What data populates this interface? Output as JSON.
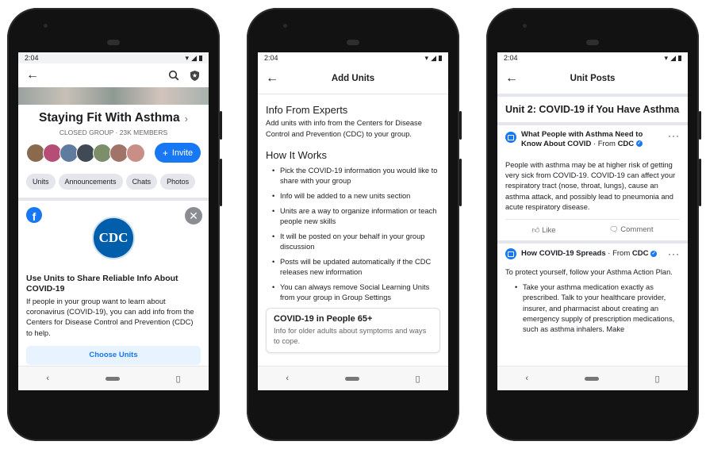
{
  "phone1": {
    "status_time": "2:04",
    "group_title": "Staying Fit With Asthma",
    "group_meta": "CLOSED GROUP · 23K MEMBERS",
    "invite_label": "Invite",
    "tabs": [
      "Units",
      "Announcements",
      "Chats",
      "Photos"
    ],
    "card": {
      "logo_text": "CDC",
      "heading": "Use Units to Share Reliable Info About COVID-19",
      "body": "If people in your group want to learn about coronavirus (COVID-19), you can add info from the Centers for Disease Control and Prevention (CDC) to help.",
      "button": "Choose Units"
    }
  },
  "phone2": {
    "status_time": "2:04",
    "title": "Add Units",
    "section1_heading": "Info From Experts",
    "section1_body": "Add units with info from the Centers for Disease Control and Prevention (CDC) to your group.",
    "section2_heading": "How It Works",
    "bullets": [
      "Pick the COVID-19 information you would like to share with your group",
      "Info will be added to a new units section",
      "Units are a way to organize information or teach people new skills",
      "It will be posted on your behalf in your group discussion",
      "Posts will be updated automatically if the CDC releases new information",
      "You can always remove Social Learning Units from your group in Group Settings"
    ],
    "unit_card": {
      "title": "COVID-19 in People 65+",
      "body": "Info for older adults about symptoms and ways to cope."
    }
  },
  "phone3": {
    "status_time": "2:04",
    "title": "Unit Posts",
    "unit_heading": "Unit 2: COVID-19 if You Have Asthma",
    "post1": {
      "title": "What People with Asthma Need to Know About COVID",
      "from_label": "· From",
      "source": "CDC",
      "body": "People with asthma may be at higher risk of getting very sick from COVID-19. COVID-19 can affect your respiratory tract (nose, throat, lungs), cause an asthma attack, and possibly lead to pneumonia and acute respiratory disease.",
      "like_label": "Like",
      "comment_label": "Comment"
    },
    "post2": {
      "title": "How COVID-19 Spreads",
      "from_label": "· From",
      "source": "CDC",
      "intro": "To protect yourself, follow your Asthma Action Plan.",
      "bullet": "Take your asthma medication exactly as prescribed. Talk to your healthcare provider, insurer, and pharmacist about creating an emergency supply of prescription medications, such as asthma inhalers. Make"
    }
  },
  "colors": {
    "fb_blue": "#1877f2",
    "cdc_blue": "#005eaa",
    "pill_gray": "#e4e6eb"
  }
}
